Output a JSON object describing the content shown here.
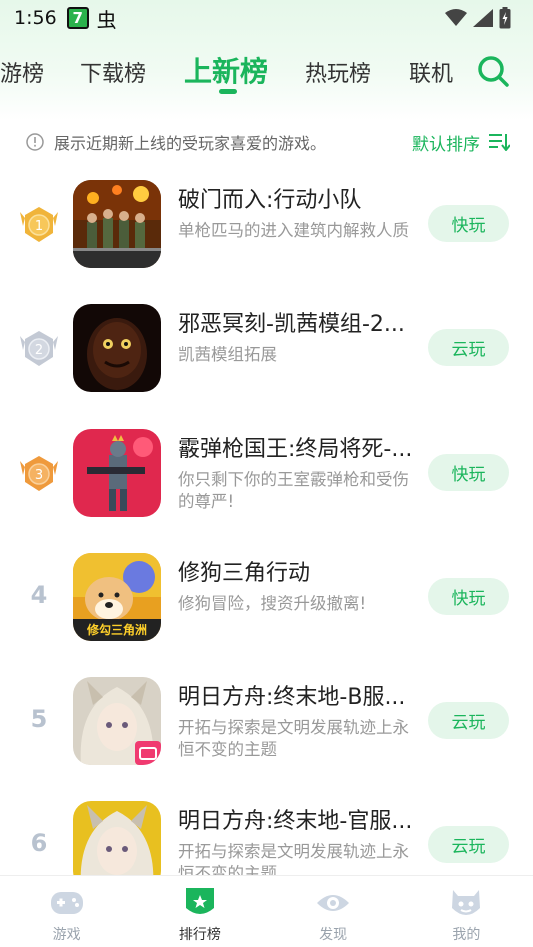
{
  "status_bar": {
    "time": "1:56",
    "app_badge": "7",
    "bug_glyph": "虫"
  },
  "tabs": [
    {
      "label": "游榜"
    },
    {
      "label": "下载榜"
    },
    {
      "label": "上新榜"
    },
    {
      "label": "热玩榜"
    },
    {
      "label": "联机"
    }
  ],
  "active_tab": "上新榜",
  "notice": {
    "text": "展示近期新上线的受玩家喜爱的游戏。",
    "sort_label": "默认排序"
  },
  "games": [
    {
      "rank": "1",
      "title": "破门而入:行动小队",
      "desc": "单枪匹马的进入建筑内解救人质",
      "action": "快玩"
    },
    {
      "rank": "2",
      "title": "邪恶冥刻-凯茜模组-2...",
      "desc": "凯茜模组拓展",
      "action": "云玩"
    },
    {
      "rank": "3",
      "title": "霰弹枪国王:终局将死-...",
      "desc": "你只剩下你的王室霰弹枪和受伤的尊严!",
      "action": "快玩"
    },
    {
      "rank": "4",
      "title": "修狗三角行动",
      "desc": "修狗冒险，搜资升级撤离!",
      "action": "快玩",
      "icon_text": "修勾三角洲"
    },
    {
      "rank": "5",
      "title": "明日方舟:终末地-B服...",
      "desc": "开拓与探索是文明发展轨迹上永恒不变的主题",
      "action": "云玩"
    },
    {
      "rank": "6",
      "title": "明日方舟:终末地-官服...",
      "desc": "开拓与探索是文明发展轨迹上永恒不变的主题",
      "action": "云玩"
    }
  ],
  "bottom_nav": [
    {
      "label": "游戏",
      "icon": "gamepad-icon"
    },
    {
      "label": "排行榜",
      "icon": "ranking-shield-icon"
    },
    {
      "label": "发现",
      "icon": "eye-icon"
    },
    {
      "label": "我的",
      "icon": "monster-face-icon"
    }
  ],
  "colors": {
    "accent": "#1bb55c",
    "gold": "#f0b43a",
    "silver": "#c3c9d4",
    "bronze": "#ef9a3c"
  }
}
